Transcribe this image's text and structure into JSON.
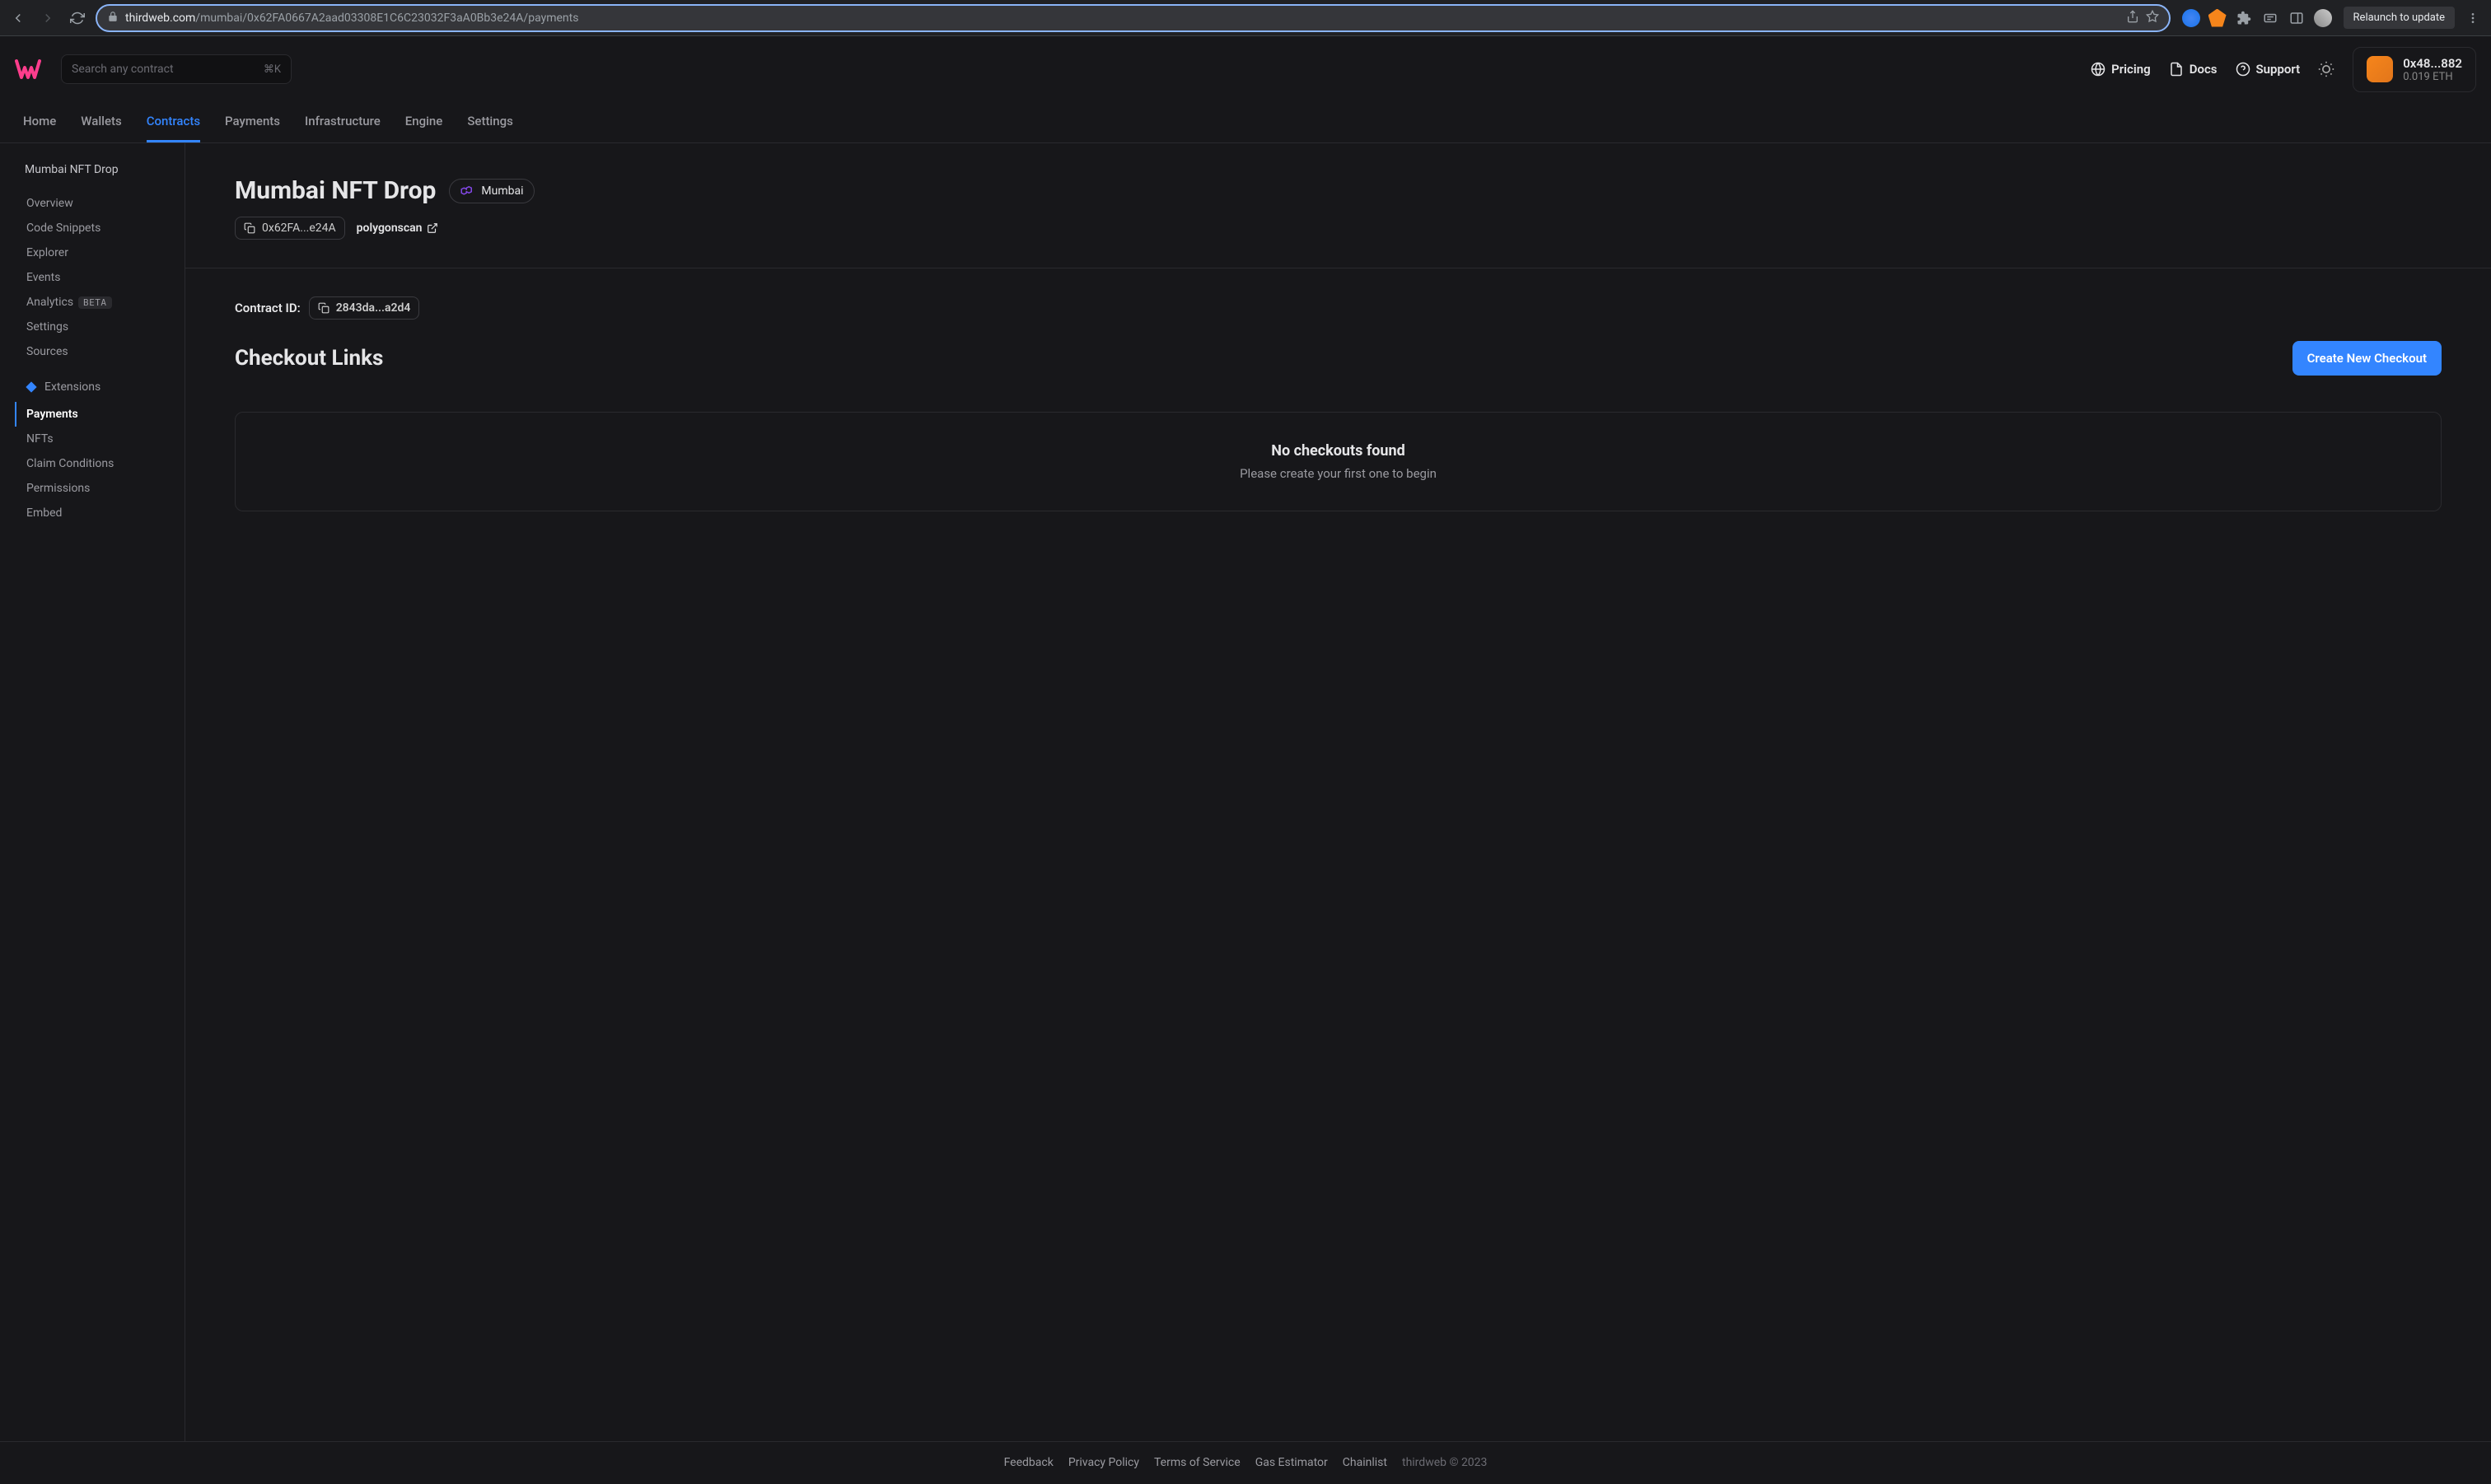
{
  "browser": {
    "url_domain": "thirdweb.com",
    "url_path": "/mumbai/0x62FA0667A2aad03308E1C6C23032F3aA0Bb3e24A/payments",
    "relaunch": "Relaunch to update"
  },
  "header": {
    "search_placeholder": "Search any contract",
    "search_hint": "⌘K",
    "links": {
      "pricing": "Pricing",
      "docs": "Docs",
      "support": "Support"
    },
    "wallet": {
      "address": "0x48...882",
      "balance": "0.019 ETH"
    }
  },
  "nav": {
    "items": [
      "Home",
      "Wallets",
      "Contracts",
      "Payments",
      "Infrastructure",
      "Engine",
      "Settings"
    ],
    "active_index": 2
  },
  "sidebar": {
    "title": "Mumbai NFT Drop",
    "items": [
      {
        "label": "Overview",
        "active": false
      },
      {
        "label": "Code Snippets",
        "active": false
      },
      {
        "label": "Explorer",
        "active": false
      },
      {
        "label": "Events",
        "active": false
      },
      {
        "label": "Analytics",
        "badge": "BETA",
        "active": false
      },
      {
        "label": "Settings",
        "active": false
      },
      {
        "label": "Sources",
        "active": false
      }
    ],
    "extensions_label": "Extensions",
    "ext_items": [
      {
        "label": "Payments",
        "active": true
      },
      {
        "label": "NFTs",
        "active": false
      },
      {
        "label": "Claim Conditions",
        "active": false
      },
      {
        "label": "Permissions",
        "active": false
      },
      {
        "label": "Embed",
        "active": false
      }
    ]
  },
  "main": {
    "page_title": "Mumbai NFT Drop",
    "chain_name": "Mumbai",
    "contract_address_short": "0x62FA...e24A",
    "explorer_link": "polygonscan",
    "contract_id_label": "Contract ID:",
    "contract_id_value": "2843da...a2d4",
    "section_title": "Checkout Links",
    "create_button": "Create New Checkout",
    "empty_title": "No checkouts found",
    "empty_subtitle": "Please create your first one to begin"
  },
  "footer": {
    "links": [
      "Feedback",
      "Privacy Policy",
      "Terms of Service",
      "Gas Estimator",
      "Chainlist"
    ],
    "copyright": "thirdweb © 2023"
  }
}
